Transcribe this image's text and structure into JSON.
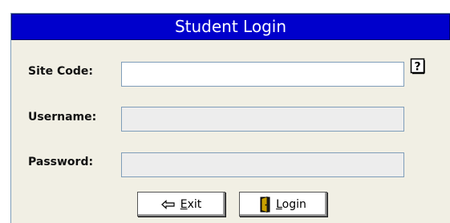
{
  "title": "Student Login",
  "fields": {
    "site_code": {
      "label": "Site Code:",
      "value": "",
      "placeholder": ""
    },
    "username": {
      "label": "Username:",
      "value": "",
      "placeholder": ""
    },
    "password": {
      "label": "Password:",
      "value": "",
      "placeholder": ""
    }
  },
  "help_icon": "question-mark-help-icon",
  "buttons": {
    "exit": {
      "label": "Exit",
      "icon": "left-arrow-icon"
    },
    "login": {
      "label": "Login",
      "icon": "door-icon"
    }
  },
  "colors": {
    "title_bar": "#0000cc",
    "panel_bg": "#f1efe4",
    "disabled_input": "#ededed"
  }
}
